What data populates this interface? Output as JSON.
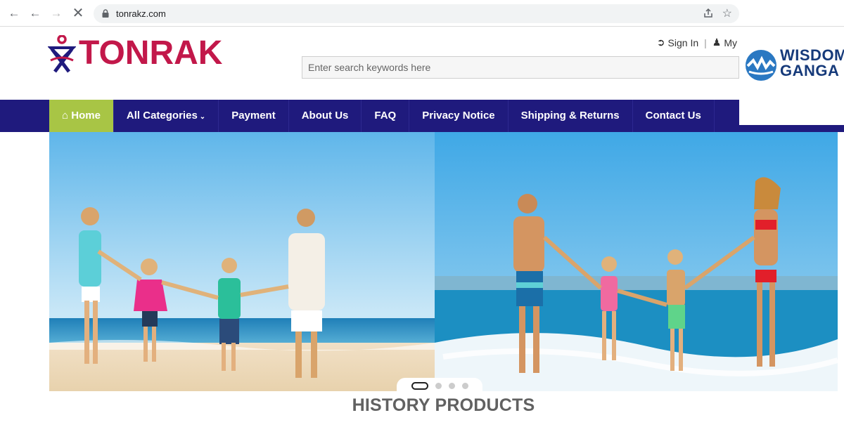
{
  "browser": {
    "url": "tonrakz.com",
    "icons": [
      "back-arrow-icon",
      "back-history-icon",
      "forward-arrow-icon",
      "stop-loading-icon",
      "lock-icon",
      "share-icon",
      "bookmark-star-icon"
    ]
  },
  "site": {
    "logo_text": "TONRAK",
    "brand_color": "#c2184a",
    "nav_color": "#1f1a7d",
    "active_color": "#a8c545"
  },
  "account": {
    "sign_in": "Sign In",
    "separator": "|",
    "my": "My"
  },
  "search": {
    "placeholder": "Enter search keywords here"
  },
  "nav": {
    "items": [
      {
        "label": "Home",
        "icon": "home-icon",
        "active": true
      },
      {
        "label": "All Categories",
        "icon": "chevron-down-icon"
      },
      {
        "label": "Payment"
      },
      {
        "label": "About Us"
      },
      {
        "label": "FAQ"
      },
      {
        "label": "Privacy Notice"
      },
      {
        "label": "Shipping & Returns"
      },
      {
        "label": "Contact Us"
      }
    ]
  },
  "watermark": {
    "line1": "WISDOM",
    "line2": "GANGA"
  },
  "slider": {
    "dots": 4,
    "active_index": 0
  },
  "section": {
    "title": "HISTORY PRODUCTS"
  }
}
